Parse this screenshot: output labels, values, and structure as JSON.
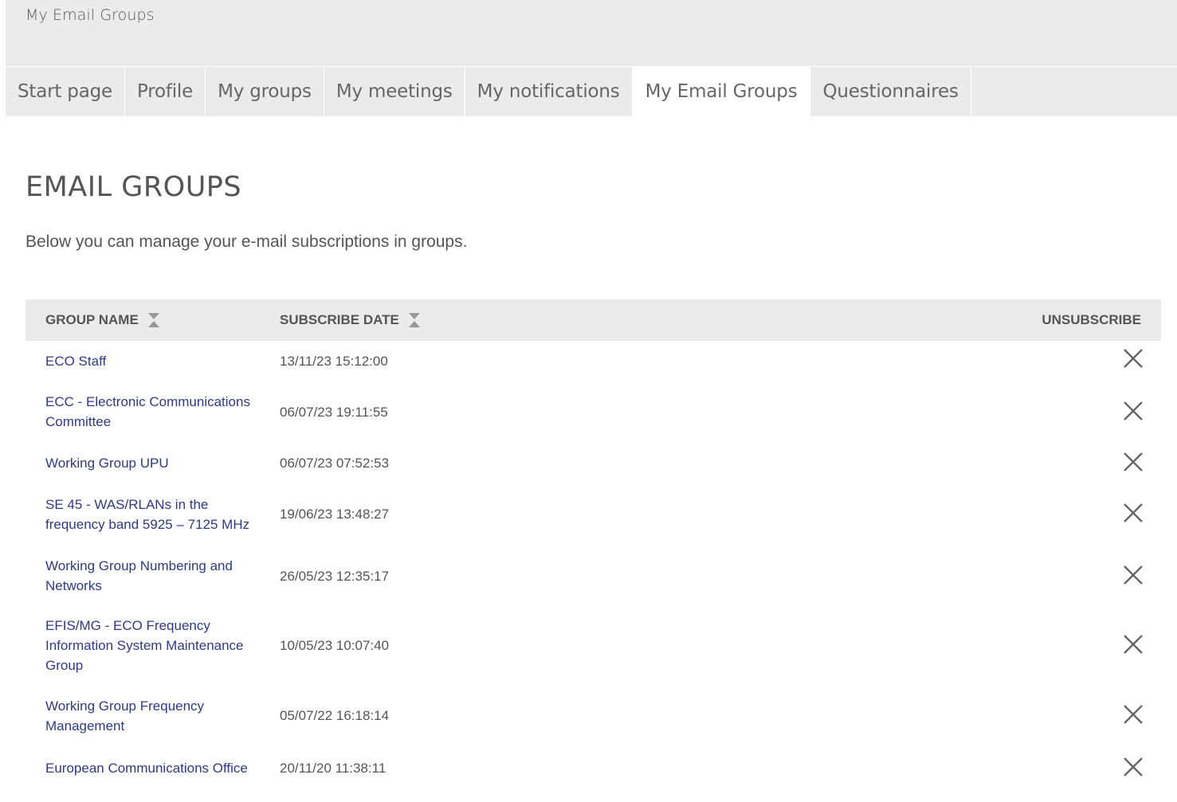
{
  "banner": {
    "title": "My Email Groups"
  },
  "tabs": [
    {
      "label": "Start page",
      "active": false
    },
    {
      "label": "Profile",
      "active": false
    },
    {
      "label": "My groups",
      "active": false
    },
    {
      "label": "My meetings",
      "active": false
    },
    {
      "label": "My notifications",
      "active": false
    },
    {
      "label": "My Email Groups",
      "active": true
    },
    {
      "label": "Questionnaires",
      "active": false
    }
  ],
  "page": {
    "title": "EMAIL GROUPS",
    "intro": "Below you can manage your e-mail subscriptions in groups."
  },
  "table": {
    "headers": {
      "group_name": "GROUP NAME",
      "subscribe_date": "SUBSCRIBE DATE",
      "unsubscribe": "UNSUBSCRIBE"
    },
    "rows": [
      {
        "name": "ECO Staff",
        "date": "13/11/23 15:12:00"
      },
      {
        "name": "ECC - Electronic Communications Committee",
        "date": "06/07/23 19:11:55"
      },
      {
        "name": "Working Group UPU",
        "date": "06/07/23 07:52:53"
      },
      {
        "name": "SE 45 - WAS/RLANs in the frequency band 5925 – 7125 MHz",
        "date": "19/06/23 13:48:27"
      },
      {
        "name": "Working Group Numbering and Networks",
        "date": "26/05/23 12:35:17"
      },
      {
        "name": "EFIS/MG - ECO Frequency Information System Maintenance Group",
        "date": "10/05/23 10:07:40"
      },
      {
        "name": "Working Group Frequency Management",
        "date": "05/07/22 16:18:14"
      },
      {
        "name": "European Communications Office",
        "date": "20/11/20 11:38:11"
      }
    ]
  },
  "icons": {
    "sort": "sort-icon",
    "unsubscribe": "close-icon"
  },
  "colors": {
    "link": "#2e3a86",
    "header_bg": "#ebebeb",
    "icon": "#666666"
  }
}
